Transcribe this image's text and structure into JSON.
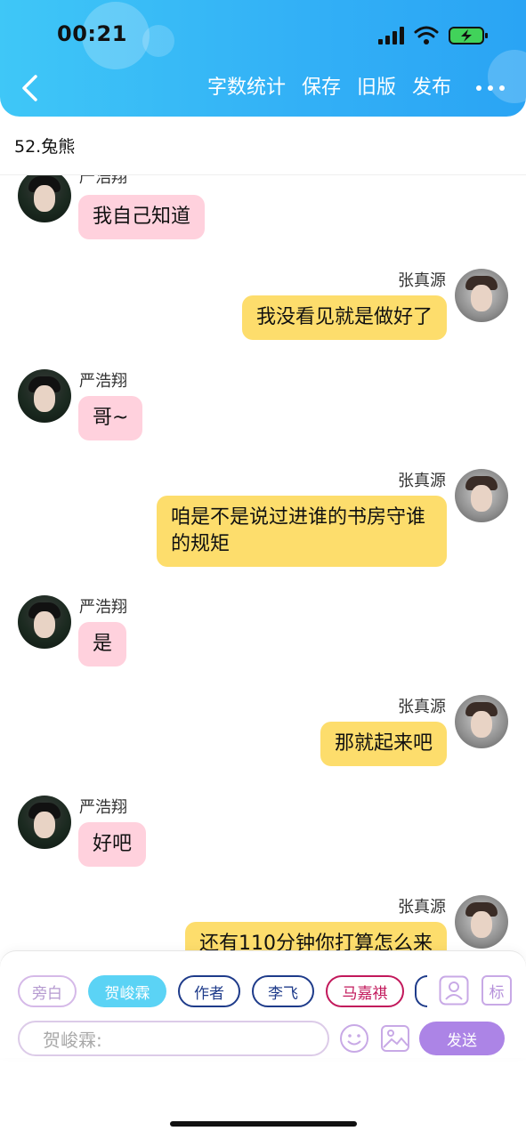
{
  "status_bar": {
    "time": "00:21"
  },
  "header": {
    "back_icon": "chevron-left-icon",
    "actions": [
      "字数统计",
      "保存",
      "旧版",
      "发布"
    ],
    "more_icon": "more-horizontal-icon"
  },
  "document": {
    "title": "52.兔熊"
  },
  "messages": [
    {
      "speaker": "严浩翔",
      "side": "left",
      "text": "我自己知道"
    },
    {
      "speaker": "张真源",
      "side": "right",
      "text": "我没看见就是做好了"
    },
    {
      "speaker": "严浩翔",
      "side": "left",
      "text": "哥~"
    },
    {
      "speaker": "张真源",
      "side": "right",
      "text": "咱是不是说过进谁的书房守谁的规矩"
    },
    {
      "speaker": "严浩翔",
      "side": "left",
      "text": "是"
    },
    {
      "speaker": "张真源",
      "side": "right",
      "text": "那就起来吧"
    },
    {
      "speaker": "严浩翔",
      "side": "left",
      "text": "好吧"
    },
    {
      "speaker": "张真源",
      "side": "right",
      "text": "还有110分钟你打算怎么来"
    }
  ],
  "toolbar": {
    "roles": [
      "旁白",
      "贺峻霖",
      "作者",
      "李飞",
      "马嘉祺"
    ],
    "selected_role": "贺峻霖",
    "input_placeholder": "贺峻霖:",
    "send_label": "发送",
    "tag_label": "标",
    "icons": [
      "person-icon",
      "tag-icon",
      "emoji-icon",
      "image-icon"
    ]
  },
  "colors": {
    "header_gradient_start": "#3fc7f7",
    "header_gradient_end": "#2aa4f4",
    "left_bubble": "#ffd1dd",
    "right_bubble": "#fddd6c",
    "send_button": "#ac84e6",
    "active_chip": "#5bd3f5"
  }
}
